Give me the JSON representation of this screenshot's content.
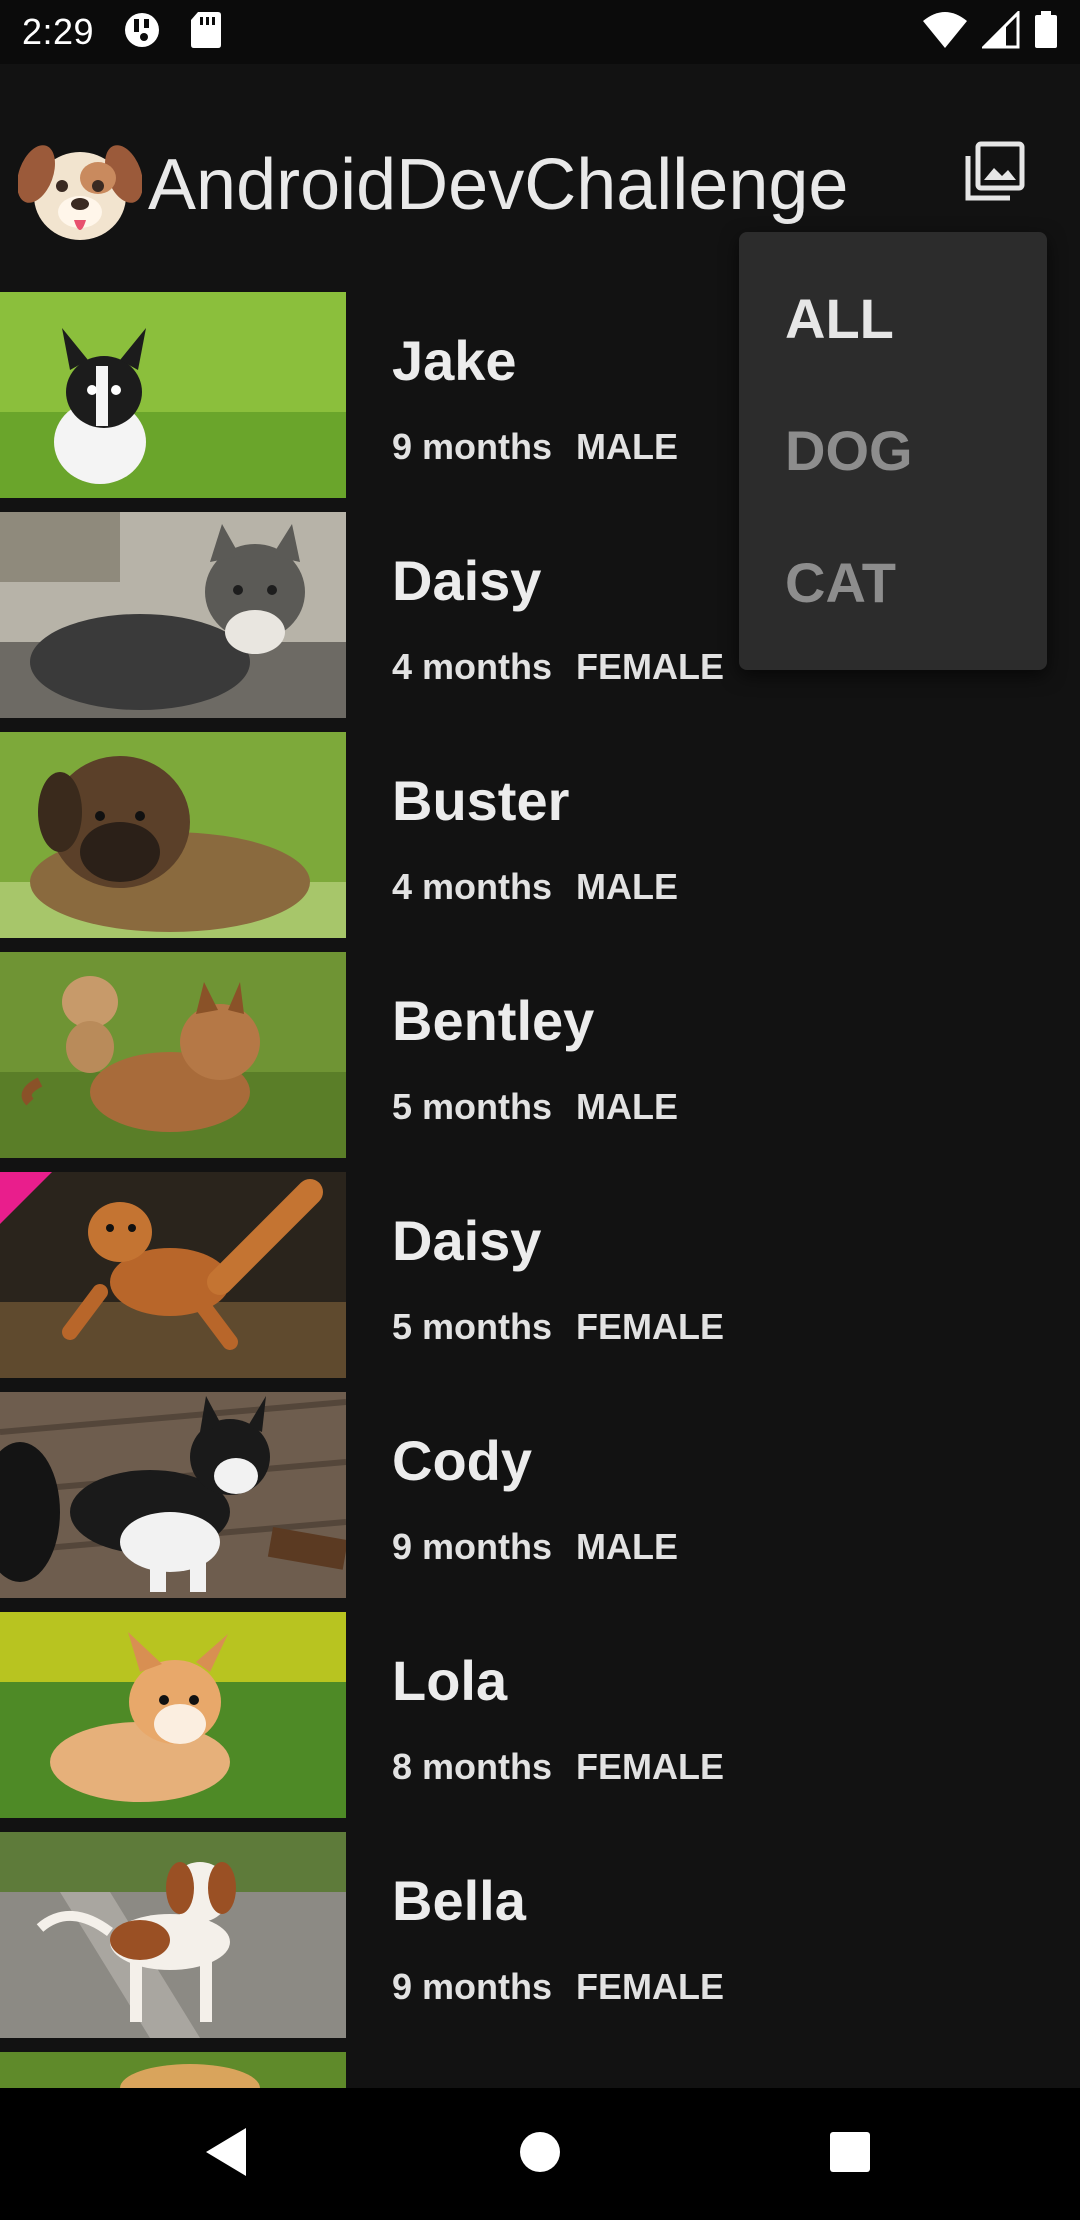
{
  "status_bar": {
    "time": "2:29",
    "left_icons": [
      "notification-icon",
      "sd-card-icon"
    ],
    "right_icons": [
      "wifi-icon",
      "signal-icon",
      "battery-icon"
    ]
  },
  "app_bar": {
    "title": "AndroidDevChallenge",
    "logo": "dog-face-logo",
    "action_icon": "photo-library-icon"
  },
  "filter_menu": {
    "items": [
      {
        "label": "ALL",
        "state": "active"
      },
      {
        "label": "DOG",
        "state": "inactive"
      },
      {
        "label": "CAT",
        "state": "inactive"
      }
    ]
  },
  "pets": [
    {
      "name": "Jake",
      "age": "9 months",
      "gender": "MALE"
    },
    {
      "name": "Daisy",
      "age": "4 months",
      "gender": "FEMALE"
    },
    {
      "name": "Buster",
      "age": "4 months",
      "gender": "MALE"
    },
    {
      "name": "Bentley",
      "age": "5 months",
      "gender": "MALE"
    },
    {
      "name": "Daisy",
      "age": "5 months",
      "gender": "FEMALE"
    },
    {
      "name": "Cody",
      "age": "9 months",
      "gender": "MALE"
    },
    {
      "name": "Lola",
      "age": "8 months",
      "gender": "FEMALE"
    },
    {
      "name": "Bella",
      "age": "9 months",
      "gender": "FEMALE"
    }
  ],
  "nav_bar": {
    "icons": [
      "back-icon",
      "home-icon",
      "recents-icon"
    ]
  },
  "colors": {
    "background": "#121212",
    "menu_background": "#2c2c2c",
    "text_primary": "#e6e6e6",
    "text_disabled": "#8d8d8d"
  }
}
